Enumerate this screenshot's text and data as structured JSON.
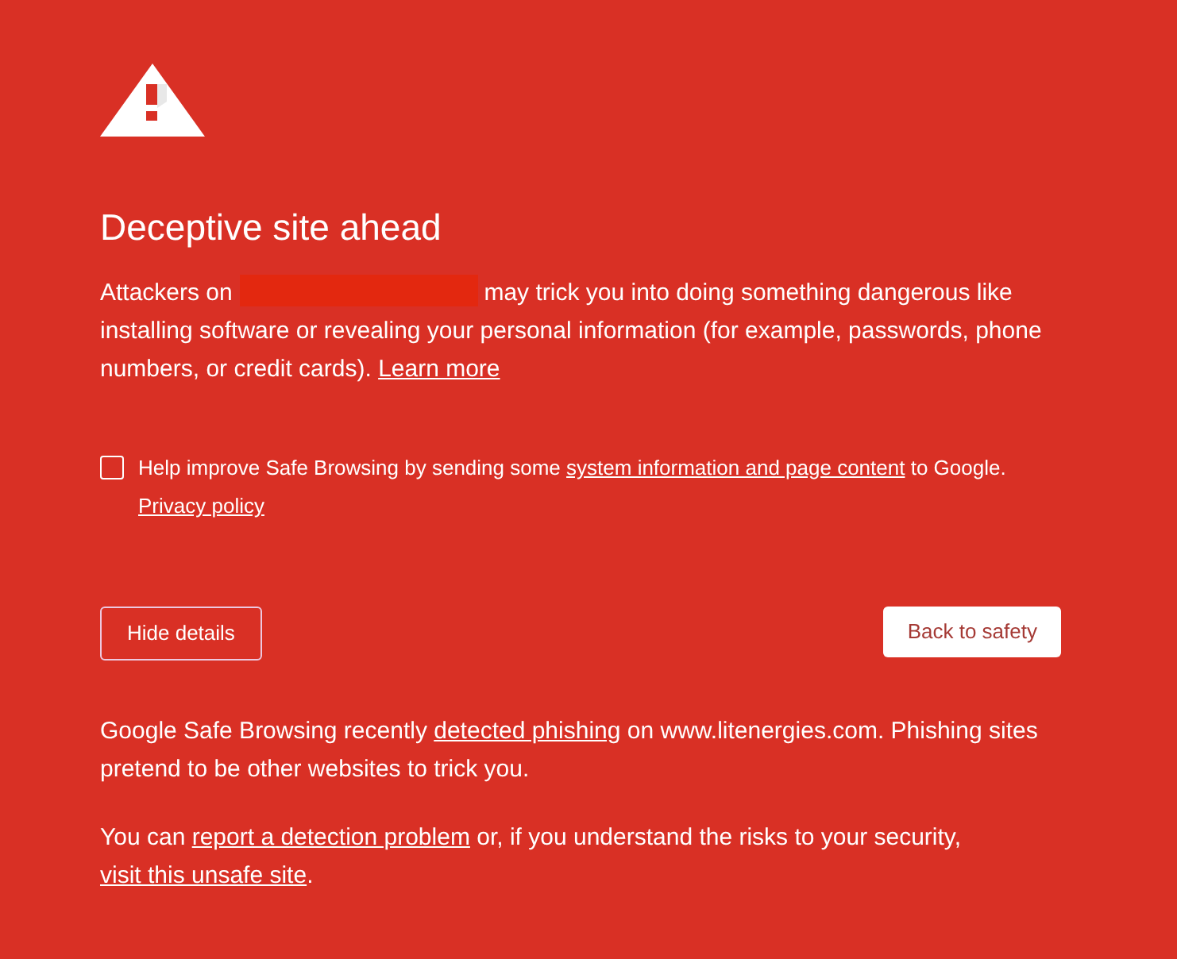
{
  "page": {
    "title": "Deceptive site ahead"
  },
  "warning": {
    "parts": [
      {
        "kind": "text",
        "text": "Attackers on "
      },
      {
        "kind": "redacted"
      },
      {
        "kind": "text",
        "text": " may trick you into doing something dangerous like installing software or revealing your personal information (for example, passwords, phone numbers, or credit cards). "
      },
      {
        "kind": "link",
        "text": "Learn more"
      }
    ]
  },
  "opt_in": {
    "checked": false,
    "parts": [
      {
        "kind": "text",
        "text": "Help improve Safe Browsing by sending some "
      },
      {
        "kind": "link",
        "text": "system information and page content"
      },
      {
        "kind": "text",
        "text": " to Google. "
      },
      {
        "kind": "link",
        "text": "Privacy policy"
      }
    ]
  },
  "buttons": [
    {
      "kind": "secondary",
      "label": "Hide details"
    },
    {
      "kind": "primary",
      "label": "Back to safety"
    }
  ],
  "details": {
    "expanded": true,
    "paragraphs": [
      [
        {
          "kind": "text",
          "text": "Google Safe Browsing recently "
        },
        {
          "kind": "link",
          "text": "detected phishing"
        },
        {
          "kind": "text",
          "text": " on www.litenergies.com. Phishing sites pretend to be other websites to trick you."
        }
      ],
      [
        {
          "kind": "text",
          "text": "You can "
        },
        {
          "kind": "link",
          "text": "report a detection problem"
        },
        {
          "kind": "text",
          "text": " or, if you understand the risks to your security, "
        },
        {
          "kind": "link",
          "text": "visit this unsafe site"
        },
        {
          "kind": "text",
          "text": "."
        }
      ]
    ]
  }
}
